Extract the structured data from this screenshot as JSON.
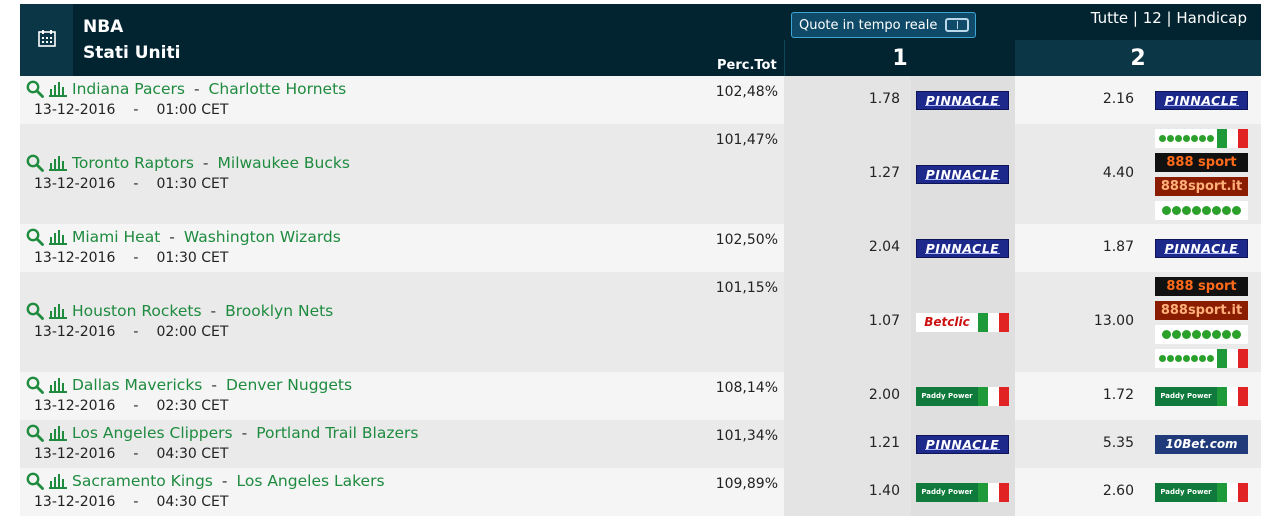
{
  "header": {
    "league": "NBA",
    "country": "Stati Uniti",
    "perc_label": "Perc.Tot",
    "realtime_label": "Quote in tempo reale",
    "filters": "Tutte | 12 | Handicap",
    "col1": "1",
    "col2": "2",
    "colors": {
      "header_bg": "#022431",
      "accent": "#1e8b3f"
    }
  },
  "matches": [
    {
      "home": "Indiana Pacers",
      "away": "Charlotte Hornets",
      "date": "13-12-2016",
      "time": "01:00 CET",
      "perc": "102,48%",
      "odd1": "1.78",
      "odd2": "2.16",
      "bm1": [
        "pinnacle"
      ],
      "bm2": [
        "pinnacle"
      ]
    },
    {
      "home": "Toronto Raptors",
      "away": "Milwaukee Bucks",
      "date": "13-12-2016",
      "time": "01:30 CET",
      "perc": "101,47%",
      "odd1": "1.27",
      "odd2": "4.40",
      "bm1": [
        "pinnacle"
      ],
      "bm2": [
        "unibet-it",
        "888sport",
        "888sport-it",
        "unibet"
      ]
    },
    {
      "home": "Miami Heat",
      "away": "Washington Wizards",
      "date": "13-12-2016",
      "time": "01:30 CET",
      "perc": "102,50%",
      "odd1": "2.04",
      "odd2": "1.87",
      "bm1": [
        "pinnacle"
      ],
      "bm2": [
        "pinnacle"
      ]
    },
    {
      "home": "Houston Rockets",
      "away": "Brooklyn Nets",
      "date": "13-12-2016",
      "time": "02:00 CET",
      "perc": "101,15%",
      "odd1": "1.07",
      "odd2": "13.00",
      "bm1": [
        "betclic-it"
      ],
      "bm2": [
        "888sport",
        "888sport-it",
        "unibet",
        "unibet-it"
      ]
    },
    {
      "home": "Dallas Mavericks",
      "away": "Denver Nuggets",
      "date": "13-12-2016",
      "time": "02:30 CET",
      "perc": "108,14%",
      "odd1": "2.00",
      "odd2": "1.72",
      "bm1": [
        "paddypower-it"
      ],
      "bm2": [
        "paddypower-it"
      ]
    },
    {
      "home": "Los Angeles Clippers",
      "away": "Portland Trail Blazers",
      "date": "13-12-2016",
      "time": "04:30 CET",
      "perc": "101,34%",
      "odd1": "1.21",
      "odd2": "5.35",
      "bm1": [
        "pinnacle"
      ],
      "bm2": [
        "10bet"
      ]
    },
    {
      "home": "Sacramento Kings",
      "away": "Los Angeles Lakers",
      "date": "13-12-2016",
      "time": "04:30 CET",
      "perc": "109,89%",
      "odd1": "1.40",
      "odd2": "2.60",
      "bm1": [
        "paddypower-it"
      ],
      "bm2": [
        "paddypower-it"
      ]
    }
  ],
  "logos": {
    "pinnacle": "PINNACLE",
    "888sport": "888 sport",
    "888sport-it": "888sport.it",
    "paddypower": "Paddy Power",
    "betclic": "Betclic",
    "10bet": "10Bet.com"
  }
}
